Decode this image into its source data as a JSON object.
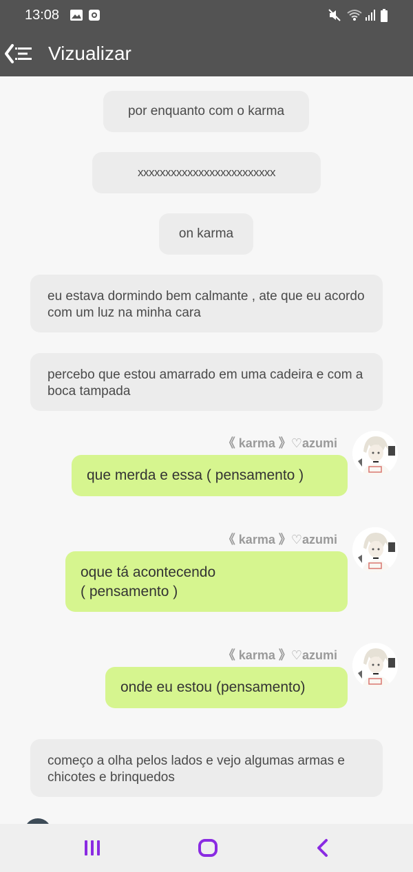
{
  "status": {
    "time": "13:08"
  },
  "header": {
    "title": "Vizualizar"
  },
  "messages": {
    "m1": "por enquanto com o karma",
    "m2": "xxxxxxxxxxxxxxxxxxxxxxxxx",
    "m3": "on karma",
    "m4": "eu estava dormindo bem calmante  , ate que eu acordo com um luz na minha cara",
    "m5": "percebo que estou amarrado em uma cadeira e com a boca tampada",
    "u1_name": "《 karma 》♡azumi",
    "u1_text": "que merda e essa ( pensamento )",
    "u2_name": "《 karma 》♡azumi",
    "u2_text_l1": "oque tá acontecendo",
    "u2_text_l2": "( pensamento )",
    "u3_name": "《 karma 》♡azumi",
    "u3_text": "onde eu estou (pensamento)",
    "m6": "começo a olha pelos lados e vejo algumas armas e chicotes e brinquedos"
  },
  "colors": {
    "bar": "#535353",
    "bubble_green": "#d6f58f",
    "bubble_grey": "#ececec",
    "nav_accent": "#8a2be2"
  },
  "icons": {
    "back": "back-menu-icon",
    "recents": "recents-icon",
    "home": "home-icon",
    "nav_back": "nav-back-icon"
  }
}
